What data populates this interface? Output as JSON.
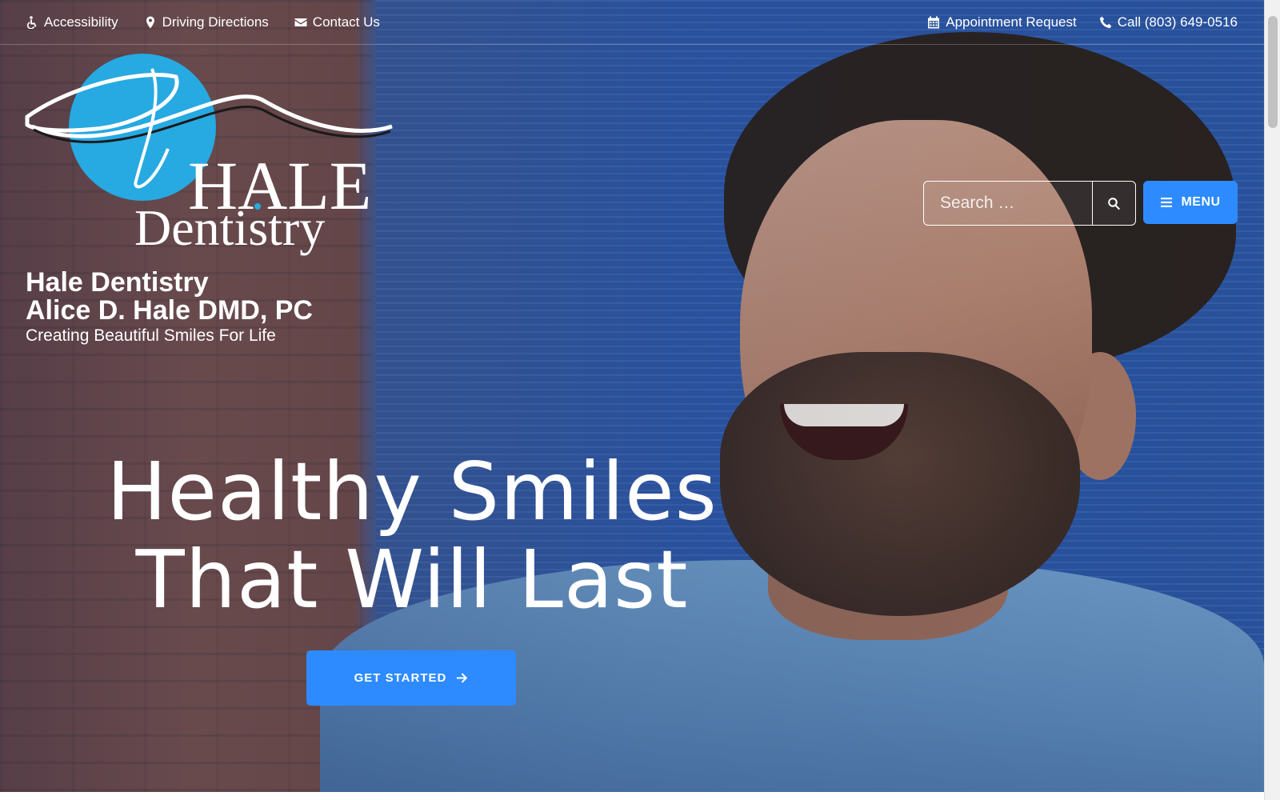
{
  "colors": {
    "accent_button": "#2e8bff",
    "logo_circle": "#27a9e1",
    "text": "#ffffff"
  },
  "topbar": {
    "left_links": [
      {
        "icon": "wheelchair-icon",
        "label": "Accessibility"
      },
      {
        "icon": "map-marker-icon",
        "label": "Driving Directions"
      },
      {
        "icon": "envelope-icon",
        "label": "Contact Us"
      }
    ],
    "right_links": [
      {
        "icon": "calendar-icon",
        "label": "Appointment Request"
      },
      {
        "icon": "phone-icon",
        "label": "Call (803) 649-0516"
      }
    ]
  },
  "logo": {
    "word_1": "HALE",
    "word_2": "Dentistry"
  },
  "practice": {
    "line_1": "Hale Dentistry",
    "line_2": "Alice D. Hale DMD, PC",
    "tagline": "Creating Beautiful Smiles For Life"
  },
  "search": {
    "placeholder": "Search …",
    "button_icon": "search-icon"
  },
  "menu": {
    "label": "MENU",
    "icon": "hamburger-icon"
  },
  "hero": {
    "headline_line_1": "Healthy Smiles",
    "headline_line_2": "That Will Last",
    "cta_label": "GET STARTED",
    "cta_icon": "arrow-right-icon"
  }
}
